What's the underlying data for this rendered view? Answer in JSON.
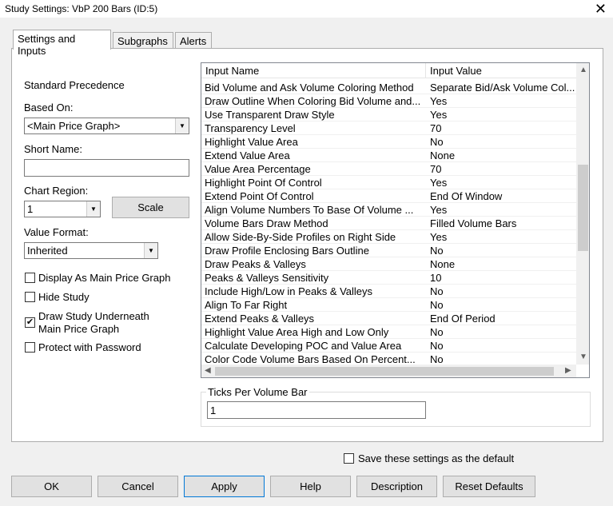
{
  "window": {
    "title": "Study Settings: VbP 200 Bars (ID:5)",
    "close": "✕"
  },
  "tabs": [
    "Settings and Inputs",
    "Subgraphs",
    "Alerts"
  ],
  "left": {
    "precedence": "Standard Precedence",
    "based_on_label": "Based On:",
    "based_on_value": "<Main Price Graph>",
    "short_name_label": "Short Name:",
    "short_name_value": "",
    "chart_region_label": "Chart Region:",
    "chart_region_value": "1",
    "scale": "Scale",
    "value_format_label": "Value Format:",
    "value_format_value": "Inherited",
    "checkboxes": [
      {
        "label": "Display As Main Price Graph",
        "checked": false
      },
      {
        "label": "Hide Study",
        "checked": false
      },
      {
        "label": "Draw Study Underneath",
        "label2": "Main Price Graph",
        "checked": true
      },
      {
        "label": "Protect with Password",
        "checked": false
      }
    ]
  },
  "grid": {
    "headers": [
      "Input Name",
      "Input Value"
    ],
    "rows": [
      [
        "Bid Volume and Ask Volume Coloring Method",
        "Separate Bid/Ask Volume Col..."
      ],
      [
        "Draw Outline When Coloring Bid Volume and...",
        "Yes"
      ],
      [
        "Use Transparent Draw Style",
        "Yes"
      ],
      [
        "Transparency Level",
        "70"
      ],
      [
        "Highlight Value Area",
        "No"
      ],
      [
        "Extend Value Area",
        "None"
      ],
      [
        "Value Area Percentage",
        "70"
      ],
      [
        "Highlight Point Of Control",
        "Yes"
      ],
      [
        "Extend Point Of Control",
        "End Of Window"
      ],
      [
        "Align Volume Numbers To Base Of Volume ...",
        "Yes"
      ],
      [
        "Volume Bars Draw Method",
        "Filled Volume Bars"
      ],
      [
        "Allow Side-By-Side Profiles on Right Side",
        "Yes"
      ],
      [
        "Draw Profile Enclosing Bars Outline",
        "No"
      ],
      [
        "Draw Peaks & Valleys",
        "None"
      ],
      [
        "Peaks & Valleys Sensitivity",
        "10"
      ],
      [
        "Include High/Low in Peaks & Valleys",
        "No"
      ],
      [
        "Align To Far Right",
        "No"
      ],
      [
        "Extend Peaks & Valleys",
        "End Of Period"
      ],
      [
        "Highlight Value Area High and Low Only",
        "No"
      ],
      [
        "Calculate Developing POC and Value Area",
        "No"
      ],
      [
        "Color Code Volume Bars Based On Percent...",
        "No"
      ]
    ]
  },
  "ticks": {
    "label": "Ticks Per Volume Bar",
    "value": "1"
  },
  "save_default": {
    "label": "Save these settings as the default",
    "checked": false
  },
  "buttons": [
    "OK",
    "Cancel",
    "Apply",
    "Help",
    "Description",
    "Reset Defaults"
  ]
}
